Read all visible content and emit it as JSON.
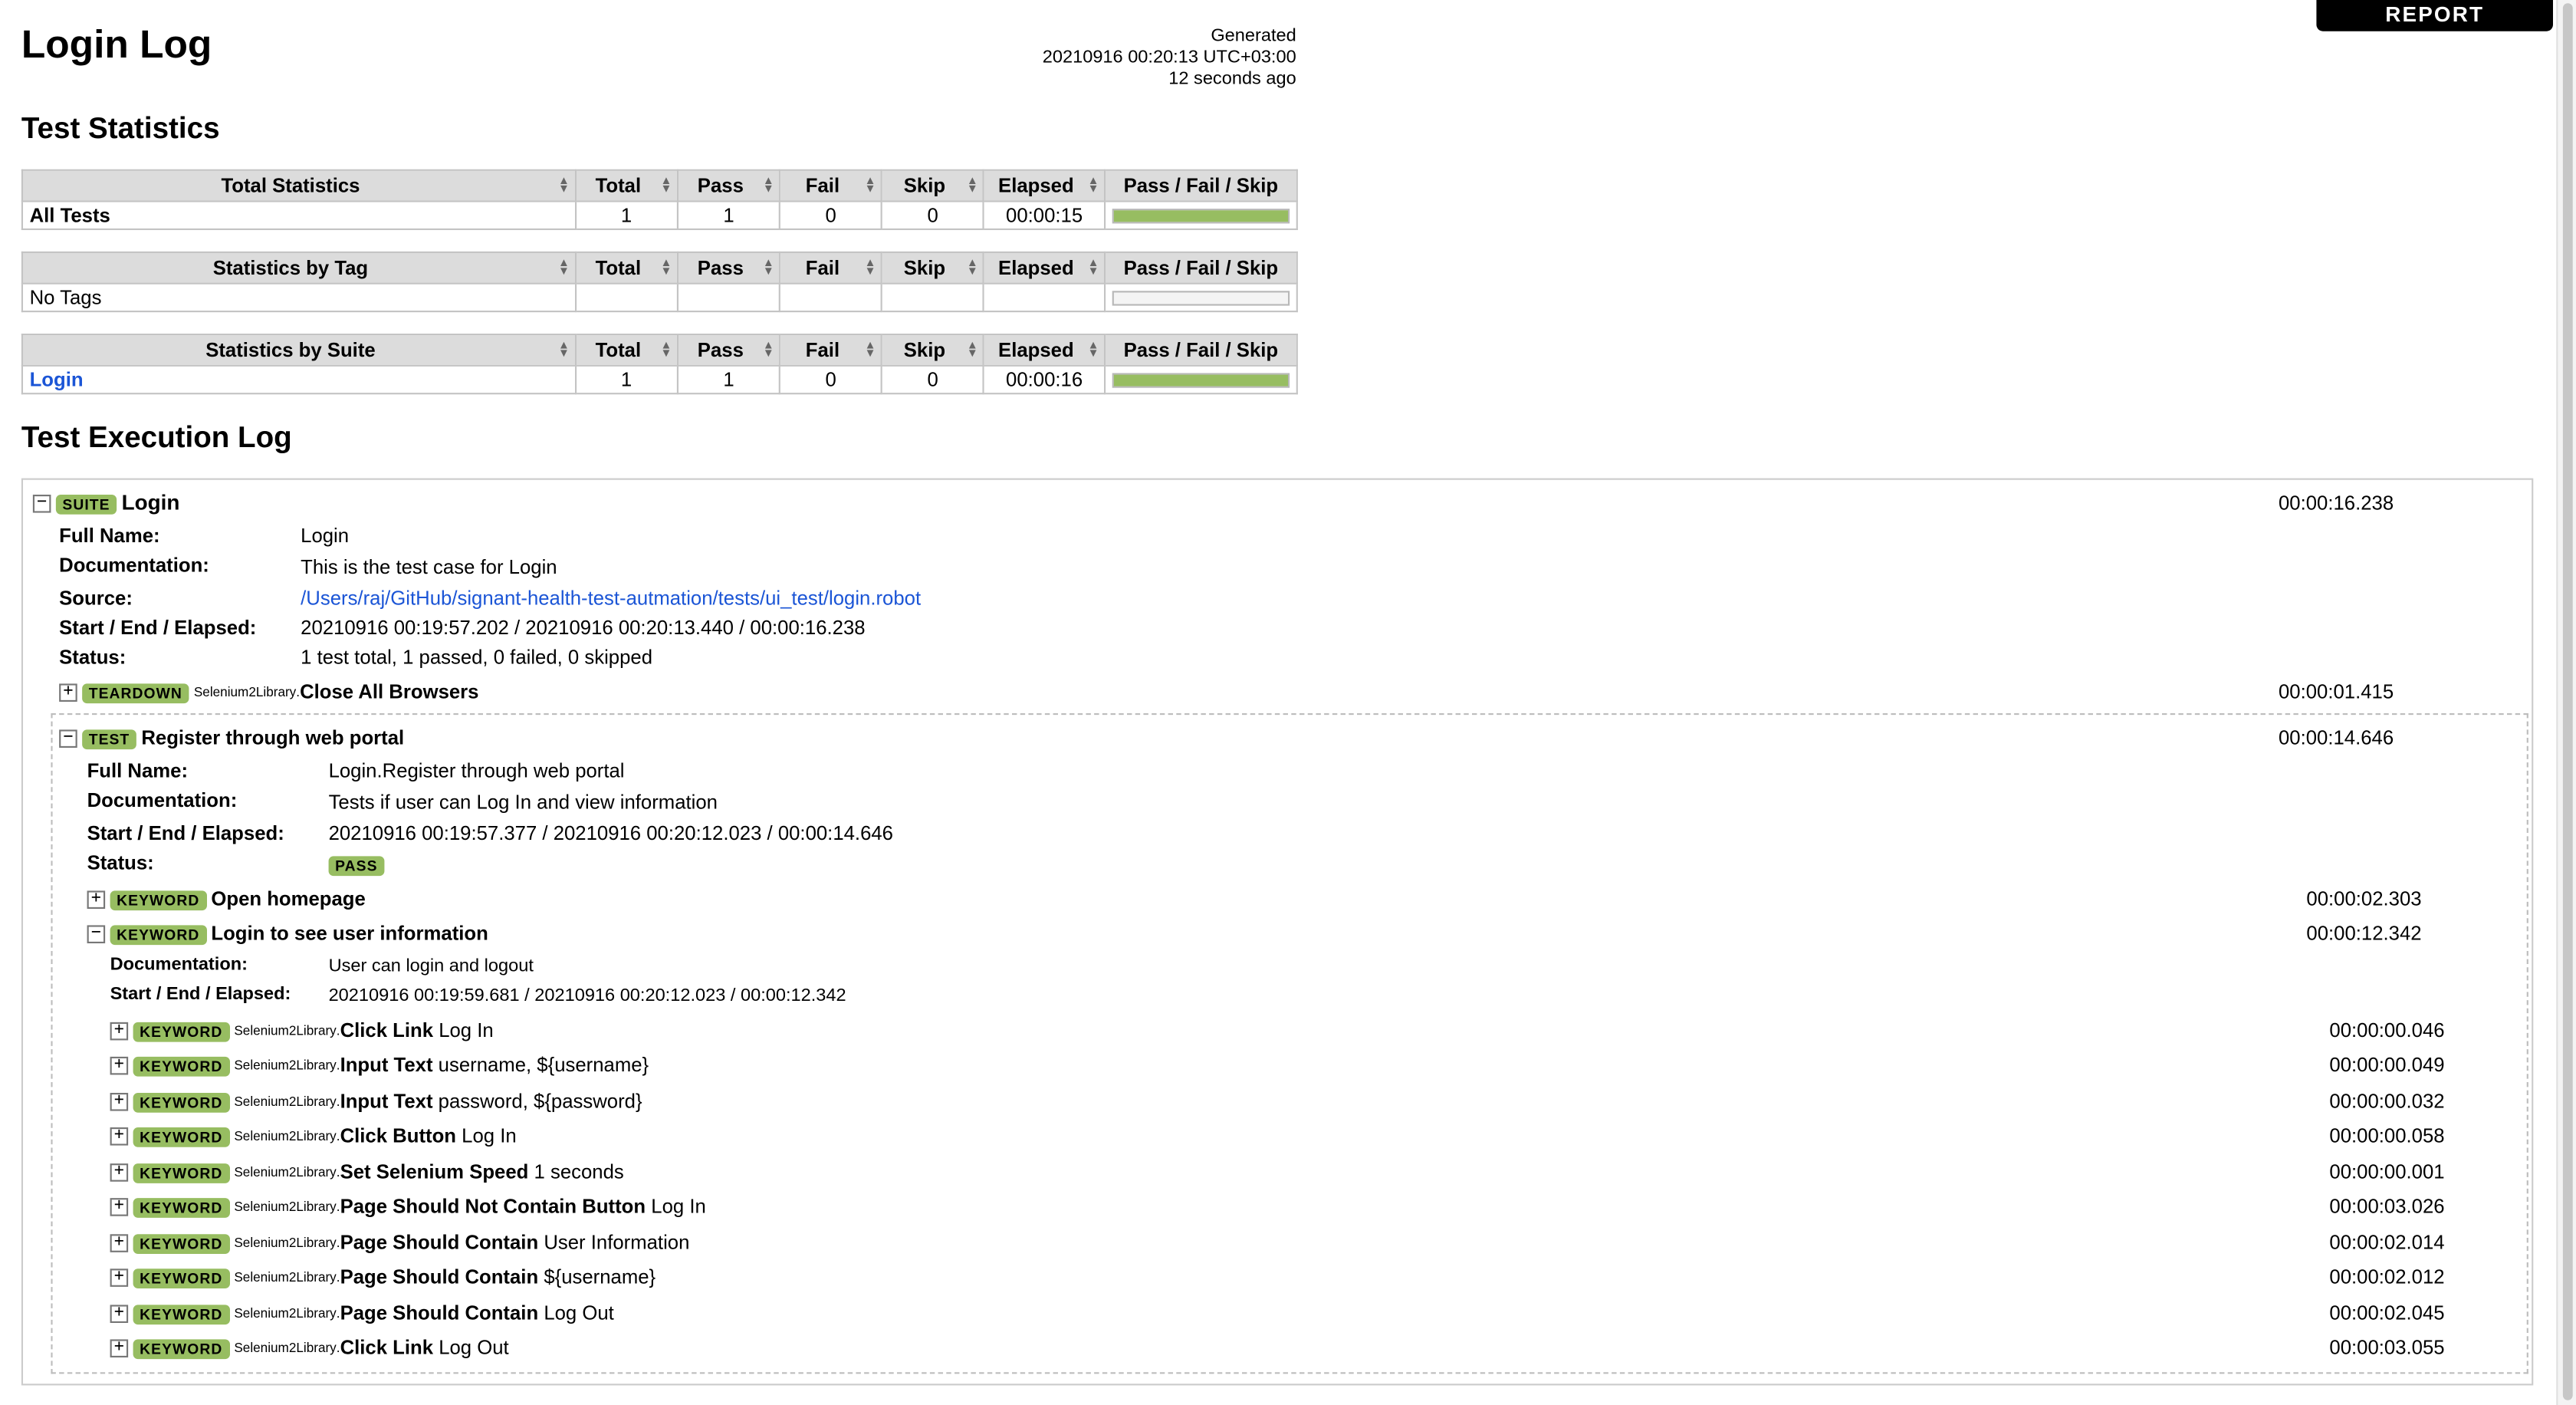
{
  "header": {
    "title": "Login Log",
    "report_label": "REPORT",
    "generated_label": "Generated",
    "generated_time": "20210916 00:20:13 UTC+03:00",
    "generated_ago": "12 seconds ago"
  },
  "sections": {
    "statistics": "Test Statistics",
    "execution": "Test Execution Log"
  },
  "stats": {
    "headers": [
      "Total",
      "Pass",
      "Fail",
      "Skip",
      "Elapsed",
      "Pass / Fail / Skip"
    ],
    "total": {
      "title": "Total Statistics",
      "name": "All Tests",
      "total": "1",
      "pass": "1",
      "fail": "0",
      "skip": "0",
      "elapsed": "00:00:15",
      "pass_fraction": 1.0
    },
    "tag": {
      "title": "Statistics by Tag",
      "name": "No Tags",
      "total": "",
      "pass": "",
      "fail": "",
      "skip": "",
      "elapsed": "",
      "pass_fraction": 0
    },
    "suite": {
      "title": "Statistics by Suite",
      "name": "Login",
      "total": "1",
      "pass": "1",
      "fail": "0",
      "skip": "0",
      "elapsed": "00:00:16",
      "pass_fraction": 1.0
    }
  },
  "suite": {
    "badge": "SUITE",
    "name": "Login",
    "elapsed": "00:00:16.238",
    "labels": {
      "full_name": "Full Name:",
      "documentation": "Documentation:",
      "source": "Source:",
      "start_end": "Start / End / Elapsed:",
      "status": "Status:"
    },
    "full_name": "Login",
    "documentation": "This is the test case for Login",
    "source": "/Users/raj/GitHub/signant-health-test-autmation/tests/ui_test/login.robot",
    "start_end": "20210916 00:19:57.202 / 20210916 00:20:13.440 / 00:00:16.238",
    "status": "1 test total, 1 passed, 0 failed, 0 skipped",
    "teardown": {
      "badge": "TEARDOWN",
      "lib": "Selenium2Library",
      "name": "Close All Browsers",
      "elapsed": "00:00:01.415"
    }
  },
  "test": {
    "badge": "TEST",
    "name": "Register through web portal",
    "elapsed": "00:00:14.646",
    "full_name": "Login.Register through web portal",
    "documentation": "Tests if user can Log In and view information",
    "start_end": "20210916 00:19:57.377 / 20210916 00:20:12.023 / 00:00:14.646",
    "status_badge": "PASS"
  },
  "keywords": {
    "badge": "KEYWORD",
    "open_homepage": {
      "name": "Open homepage",
      "elapsed": "00:00:02.303"
    },
    "login_info": {
      "name": "Login to see user information",
      "elapsed": "00:00:12.342",
      "documentation": "User can login and logout",
      "start_end": "20210916 00:19:59.681 / 20210916 00:20:12.023 / 00:00:12.342"
    },
    "lib": "Selenium2Library",
    "steps": [
      {
        "name": "Click Link",
        "args": "Log In",
        "elapsed": "00:00:00.046"
      },
      {
        "name": "Input Text",
        "args": "username, ${username}",
        "elapsed": "00:00:00.049"
      },
      {
        "name": "Input Text",
        "args": "password, ${password}",
        "elapsed": "00:00:00.032"
      },
      {
        "name": "Click Button",
        "args": "Log In",
        "elapsed": "00:00:00.058"
      },
      {
        "name": "Set Selenium Speed",
        "args": "1 seconds",
        "elapsed": "00:00:00.001"
      },
      {
        "name": "Page Should Not Contain Button",
        "args": "Log In",
        "elapsed": "00:00:03.026"
      },
      {
        "name": "Page Should Contain",
        "args": "User Information",
        "elapsed": "00:00:02.014"
      },
      {
        "name": "Page Should Contain",
        "args": "${username}",
        "elapsed": "00:00:02.012"
      },
      {
        "name": "Page Should Contain",
        "args": "Log Out",
        "elapsed": "00:00:02.045"
      },
      {
        "name": "Click Link",
        "args": "Log Out",
        "elapsed": "00:00:03.055"
      }
    ]
  },
  "icons": {
    "expand": "+",
    "collapse": "−",
    "sort": "sort-arrows-icon"
  },
  "colors": {
    "pass": "#97bd61",
    "link": "#1b55d6",
    "header_bg": "#dcdcdc"
  }
}
